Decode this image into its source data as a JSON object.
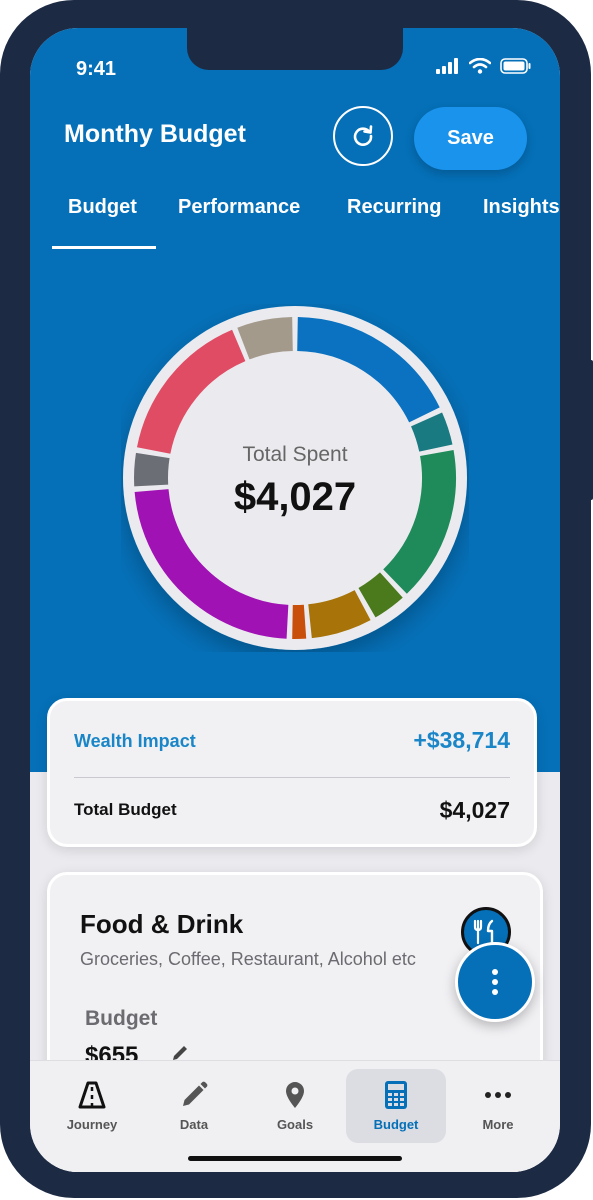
{
  "status_bar": {
    "time": "9:41",
    "icons": [
      "signal-icon",
      "wifi-icon",
      "battery-icon"
    ]
  },
  "header": {
    "title": "Monthy Budget",
    "save_label": "Save",
    "refresh_icon": "refresh-icon"
  },
  "tabs": [
    {
      "label": "Budget",
      "active": true
    },
    {
      "label": "Performance",
      "active": false
    },
    {
      "label": "Recurring",
      "active": false
    },
    {
      "label": "Insights",
      "active": false
    }
  ],
  "spending_chart": {
    "center_label": "Total Spent",
    "center_value": "$4,027",
    "segment_colors": [
      "#0a72c0",
      "#1a7a82",
      "#1f8a5a",
      "#4a7a1c",
      "#a8740a",
      "#c8500a",
      "#a012b4",
      "#6b6e75",
      "#e04c64",
      "#a49a8c"
    ]
  },
  "wealth_card": {
    "impact_label": "Wealth Impact",
    "impact_value": "+$38,714",
    "budget_label": "Total Budget",
    "budget_value": "$4,027"
  },
  "category_card": {
    "title": "Food & Drink",
    "subtitle": "Groceries, Coffee, Restaurant, Alcohol etc",
    "icon": "fork-knife-icon",
    "budget_label": "Budget",
    "budget_value": "$655"
  },
  "fab": {
    "icon": "more-vertical-icon"
  },
  "bottom_nav": [
    {
      "label": "Journey",
      "icon": "road-icon",
      "active": false
    },
    {
      "label": "Data",
      "icon": "pencil-icon",
      "active": false
    },
    {
      "label": "Goals",
      "icon": "location-pin-icon",
      "active": false
    },
    {
      "label": "Budget",
      "icon": "calculator-icon",
      "active": true
    },
    {
      "label": "More",
      "icon": "more-horizontal-icon",
      "active": false
    }
  ],
  "colors": {
    "primary_blue": "#0570b8",
    "accent_blue": "#1a86c8",
    "save_button": "#1a93ec",
    "frame": "#1c2a44"
  }
}
